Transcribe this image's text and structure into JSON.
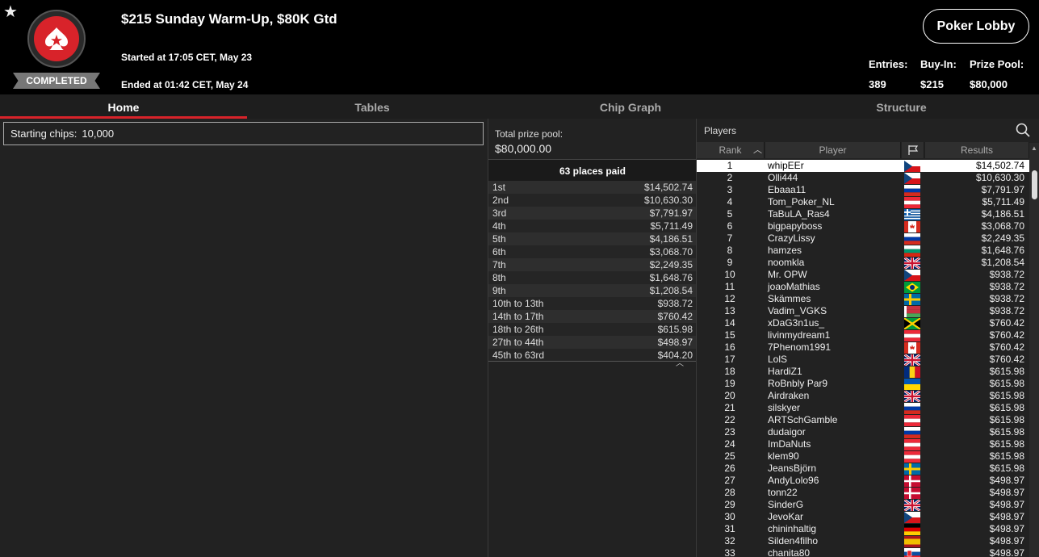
{
  "header": {
    "title": "$215 Sunday Warm-Up, $80K Gtd",
    "started": "Started at 17:05 CET, May 23",
    "ended": "Ended at 01:42 CET, May 24",
    "status": "COMPLETED",
    "lobby_button": "Poker Lobby",
    "stats": {
      "entries_label": "Entries:",
      "entries_value": "389",
      "buyin_label": "Buy-In:",
      "buyin_value": "$215",
      "prizepool_label": "Prize Pool:",
      "prizepool_value": "$80,000"
    },
    "icons": {
      "favorite": "star-icon",
      "logo": "pokerstars-logo-icon"
    }
  },
  "tabs": [
    {
      "label": "Home",
      "active": true
    },
    {
      "label": "Tables",
      "active": false
    },
    {
      "label": "Chip Graph",
      "active": false
    },
    {
      "label": "Structure",
      "active": false
    }
  ],
  "home": {
    "starting_chips_label": "Starting chips:",
    "starting_chips_value": "10,000"
  },
  "prize": {
    "total_label": "Total prize pool:",
    "total_value": "$80,000.00",
    "places_paid": "63 places paid",
    "payouts": [
      {
        "place": "1st",
        "amount": "$14,502.74"
      },
      {
        "place": "2nd",
        "amount": "$10,630.30"
      },
      {
        "place": "3rd",
        "amount": "$7,791.97"
      },
      {
        "place": "4th",
        "amount": "$5,711.49"
      },
      {
        "place": "5th",
        "amount": "$4,186.51"
      },
      {
        "place": "6th",
        "amount": "$3,068.70"
      },
      {
        "place": "7th",
        "amount": "$2,249.35"
      },
      {
        "place": "8th",
        "amount": "$1,648.76"
      },
      {
        "place": "9th",
        "amount": "$1,208.54"
      },
      {
        "place": "10th to 13th",
        "amount": "$938.72"
      },
      {
        "place": "14th to 17th",
        "amount": "$760.42"
      },
      {
        "place": "18th to 26th",
        "amount": "$615.98"
      },
      {
        "place": "27th to 44th",
        "amount": "$498.97"
      },
      {
        "place": "45th to 63rd",
        "amount": "$404.20"
      }
    ]
  },
  "players": {
    "title": "Players",
    "columns": {
      "rank": "Rank",
      "player": "Player",
      "results": "Results"
    },
    "sort_indicator": "^",
    "rows": [
      {
        "rank": "1",
        "name": "whipEEr",
        "flag": "cz",
        "result": "$14,502.74"
      },
      {
        "rank": "2",
        "name": "Olli444",
        "flag": "cz",
        "result": "$10,630.30"
      },
      {
        "rank": "3",
        "name": "Ebaaa11",
        "flag": "ru",
        "result": "$7,791.97"
      },
      {
        "rank": "4",
        "name": "Tom_Poker_NL",
        "flag": "at",
        "result": "$5,711.49"
      },
      {
        "rank": "5",
        "name": "TaBuLA_Ras4",
        "flag": "gr",
        "result": "$4,186.51"
      },
      {
        "rank": "6",
        "name": "bigpapyboss",
        "flag": "ca",
        "result": "$3,068.70"
      },
      {
        "rank": "7",
        "name": "CrazyLissy",
        "flag": "ru",
        "result": "$2,249.35"
      },
      {
        "rank": "8",
        "name": "hamzes",
        "flag": "bg",
        "result": "$1,648.76"
      },
      {
        "rank": "9",
        "name": "noomkla",
        "flag": "gb",
        "result": "$1,208.54"
      },
      {
        "rank": "10",
        "name": "Mr. OPW",
        "flag": "cz",
        "result": "$938.72"
      },
      {
        "rank": "11",
        "name": "joaoMathias",
        "flag": "br",
        "result": "$938.72"
      },
      {
        "rank": "12",
        "name": "Skämmes",
        "flag": "se",
        "result": "$938.72"
      },
      {
        "rank": "13",
        "name": "Vadim_VGKS",
        "flag": "by",
        "result": "$938.72"
      },
      {
        "rank": "14",
        "name": "xDaG3n1us_",
        "flag": "jm",
        "result": "$760.42"
      },
      {
        "rank": "15",
        "name": "livinmydream1",
        "flag": "at",
        "result": "$760.42"
      },
      {
        "rank": "16",
        "name": "7Phenom1991",
        "flag": "ca",
        "result": "$760.42"
      },
      {
        "rank": "17",
        "name": "LolS",
        "flag": "gb",
        "result": "$760.42"
      },
      {
        "rank": "18",
        "name": "HardiZ1",
        "flag": "ro",
        "result": "$615.98"
      },
      {
        "rank": "19",
        "name": "RoBnbly Par9",
        "flag": "ua",
        "result": "$615.98"
      },
      {
        "rank": "20",
        "name": "Airdraken",
        "flag": "gb",
        "result": "$615.98"
      },
      {
        "rank": "21",
        "name": "silskyer",
        "flag": "ru",
        "result": "$615.98"
      },
      {
        "rank": "22",
        "name": "ARTSchGamble",
        "flag": "at",
        "result": "$615.98"
      },
      {
        "rank": "23",
        "name": "dudaigor",
        "flag": "ru",
        "result": "$615.98"
      },
      {
        "rank": "24",
        "name": "ImDaNuts",
        "flag": "at",
        "result": "$615.98"
      },
      {
        "rank": "25",
        "name": "klem90",
        "flag": "at",
        "result": "$615.98"
      },
      {
        "rank": "26",
        "name": "JeansBjörn",
        "flag": "se",
        "result": "$615.98"
      },
      {
        "rank": "27",
        "name": "AndyLolo96",
        "flag": "dk",
        "result": "$498.97"
      },
      {
        "rank": "28",
        "name": "tonn22",
        "flag": "dk",
        "result": "$498.97"
      },
      {
        "rank": "29",
        "name": "SinderG",
        "flag": "gb",
        "result": "$498.97"
      },
      {
        "rank": "30",
        "name": "JevoKar",
        "flag": "cz",
        "result": "$498.97"
      },
      {
        "rank": "31",
        "name": "chininhaltig",
        "flag": "de",
        "result": "$498.97"
      },
      {
        "rank": "32",
        "name": "Silden4filho",
        "flag": "es",
        "result": "$498.97"
      },
      {
        "rank": "33",
        "name": "chanita80",
        "flag": "sk",
        "result": "$498.97"
      }
    ]
  },
  "colors": {
    "accent": "#d8232a",
    "background": "#000000",
    "panel": "#222222"
  }
}
